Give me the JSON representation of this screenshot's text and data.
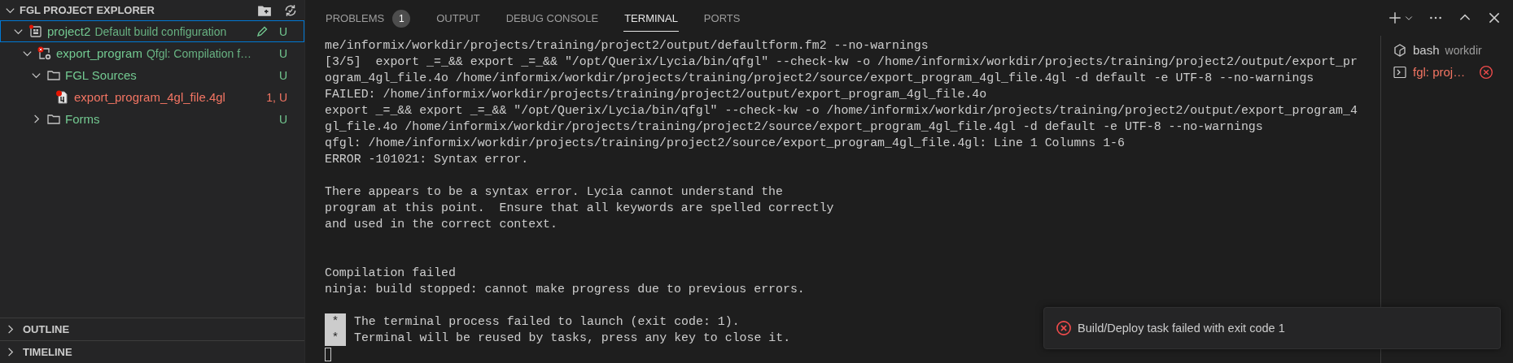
{
  "sidebar": {
    "title": "FGL PROJECT EXPLORER",
    "tree": [
      {
        "kind": "project",
        "label": "project2",
        "description": "Default build configuration",
        "decoration": "U",
        "expanded": true,
        "selected": true,
        "error": true,
        "children": [
          {
            "kind": "program",
            "label": "export_program",
            "description": "Qfgl: Compilation f…",
            "decoration": "U",
            "expanded": true,
            "selected": false,
            "error": true,
            "children": [
              {
                "kind": "folder",
                "label": "FGL Sources",
                "decoration": "U",
                "expanded": true,
                "selected": false,
                "children": [
                  {
                    "kind": "file",
                    "label": "export_program_4gl_file.4gl",
                    "decoration": "1, U",
                    "selected": false,
                    "error": true
                  }
                ]
              },
              {
                "kind": "folder",
                "label": "Forms",
                "decoration": "U",
                "expanded": false,
                "selected": false
              }
            ]
          }
        ]
      }
    ],
    "sections": [
      {
        "label": "OUTLINE",
        "expanded": false
      },
      {
        "label": "TIMELINE",
        "expanded": false
      }
    ]
  },
  "panel": {
    "tabs": [
      {
        "label": "PROBLEMS",
        "badge": "1",
        "selected": false
      },
      {
        "label": "OUTPUT",
        "selected": false
      },
      {
        "label": "DEBUG CONSOLE",
        "selected": false
      },
      {
        "label": "TERMINAL",
        "selected": true
      },
      {
        "label": "PORTS",
        "selected": false
      }
    ],
    "terminal_lines": [
      {
        "kind": "text",
        "text": "me/informix/workdir/projects/training/project2/output/defaultform.fm2 --no-warnings"
      },
      {
        "kind": "text",
        "text": "[3/5]  export _=_&& export _=_&& \"/opt/Querix/Lycia/bin/qfgl\" --check-kw -o /home/informix/workdir/projects/training/project2/output/export_pr"
      },
      {
        "kind": "text",
        "text": "ogram_4gl_file.4o /home/informix/workdir/projects/training/project2/source/export_program_4gl_file.4gl -d default -e UTF-8 --no-warnings"
      },
      {
        "kind": "text",
        "text": "FAILED: /home/informix/workdir/projects/training/project2/output/export_program_4gl_file.4o"
      },
      {
        "kind": "text",
        "text": "export _=_&& export _=_&& \"/opt/Querix/Lycia/bin/qfgl\" --check-kw -o /home/informix/workdir/projects/training/project2/output/export_program_4"
      },
      {
        "kind": "text",
        "text": "gl_file.4o /home/informix/workdir/projects/training/project2/source/export_program_4gl_file.4gl -d default -e UTF-8 --no-warnings"
      },
      {
        "kind": "text",
        "text": "qfgl: /home/informix/workdir/projects/training/project2/source/export_program_4gl_file.4gl: Line 1 Columns 1-6"
      },
      {
        "kind": "text",
        "text": "ERROR -101021: Syntax error."
      },
      {
        "kind": "blank"
      },
      {
        "kind": "text",
        "text": "There appears to be a syntax error. Lycia cannot understand the"
      },
      {
        "kind": "text",
        "text": "program at this point.  Ensure that all keywords are spelled correctly"
      },
      {
        "kind": "text",
        "text": "and used in the correct context."
      },
      {
        "kind": "blank"
      },
      {
        "kind": "blank"
      },
      {
        "kind": "text",
        "text": "Compilation failed"
      },
      {
        "kind": "text",
        "text": "ninja: build stopped: cannot make progress due to previous errors."
      },
      {
        "kind": "blank"
      },
      {
        "kind": "marker",
        "marker": "*",
        "text": "The terminal process failed to launch (exit code: 1)."
      },
      {
        "kind": "marker",
        "marker": "*",
        "text": "Terminal will be reused by tasks, press any key to close it."
      },
      {
        "kind": "cursor"
      }
    ],
    "terminals": [
      {
        "kind": "bash",
        "name": "bash",
        "detail": "workdir",
        "error": false
      },
      {
        "kind": "task",
        "name": "fgl: proj…",
        "error": true
      }
    ]
  },
  "notification": {
    "kind": "error",
    "message": "Build/Deploy task failed with exit code 1"
  }
}
